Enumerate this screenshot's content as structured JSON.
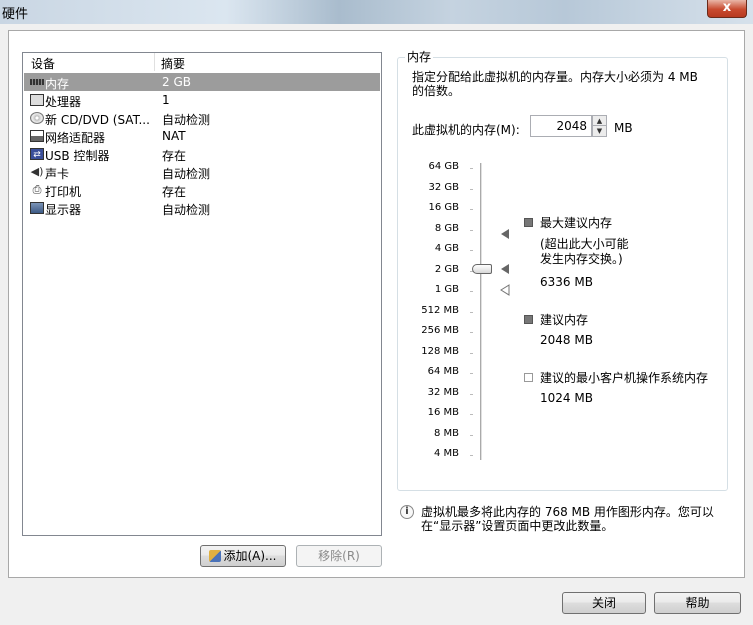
{
  "window": {
    "title": "硬件",
    "close_glyph": "x"
  },
  "device_list": {
    "headers": {
      "device": "设备",
      "summary": "摘要"
    },
    "rows": [
      {
        "icon": "memory-icon",
        "name": "内存",
        "summary": "2 GB",
        "selected": true
      },
      {
        "icon": "processor-icon",
        "name": "处理器",
        "summary": "1"
      },
      {
        "icon": "cd-dvd-icon",
        "name": "新 CD/DVD (SAT...",
        "summary": "自动检测"
      },
      {
        "icon": "network-adapter-icon",
        "name": "网络适配器",
        "summary": "NAT"
      },
      {
        "icon": "usb-controller-icon",
        "name": "USB 控制器",
        "summary": "存在"
      },
      {
        "icon": "sound-card-icon",
        "name": "声卡",
        "summary": "自动检测"
      },
      {
        "icon": "printer-icon",
        "name": "打印机",
        "summary": "存在"
      },
      {
        "icon": "display-icon",
        "name": "显示器",
        "summary": "自动检测"
      }
    ],
    "add_button": "添加(A)...",
    "remove_button": "移除(R)"
  },
  "memory": {
    "group_title": "内存",
    "description": "指定分配给此虚拟机的内存量。内存大小必须为 4 MB 的倍数。",
    "label": "此虚拟机的内存(M):",
    "value": "2048",
    "unit": "MB",
    "scale": [
      "64 GB",
      "32 GB",
      "16 GB",
      "8 GB",
      "4 GB",
      "2 GB",
      "1 GB",
      "512 MB",
      "256 MB",
      "128 MB",
      "64 MB",
      "32 MB",
      "16 MB",
      "8 MB",
      "4 MB"
    ],
    "slider_value": "2 GB",
    "legend": {
      "max_title": "最大建议内存",
      "max_note_1": "(超出此大小可能",
      "max_note_2": "发生内存交换。)",
      "max_value": "6336 MB",
      "rec_title": "建议内存",
      "rec_value": "2048 MB",
      "min_title": "建议的最小客户机操作系统内存",
      "min_value": "1024 MB"
    },
    "info_text": "虚拟机最多将此内存的 768 MB 用作图形内存。您可以在“显示器”设置页面中更改此数量。"
  },
  "footer": {
    "close_button": "关闭",
    "help_button": "帮助"
  }
}
